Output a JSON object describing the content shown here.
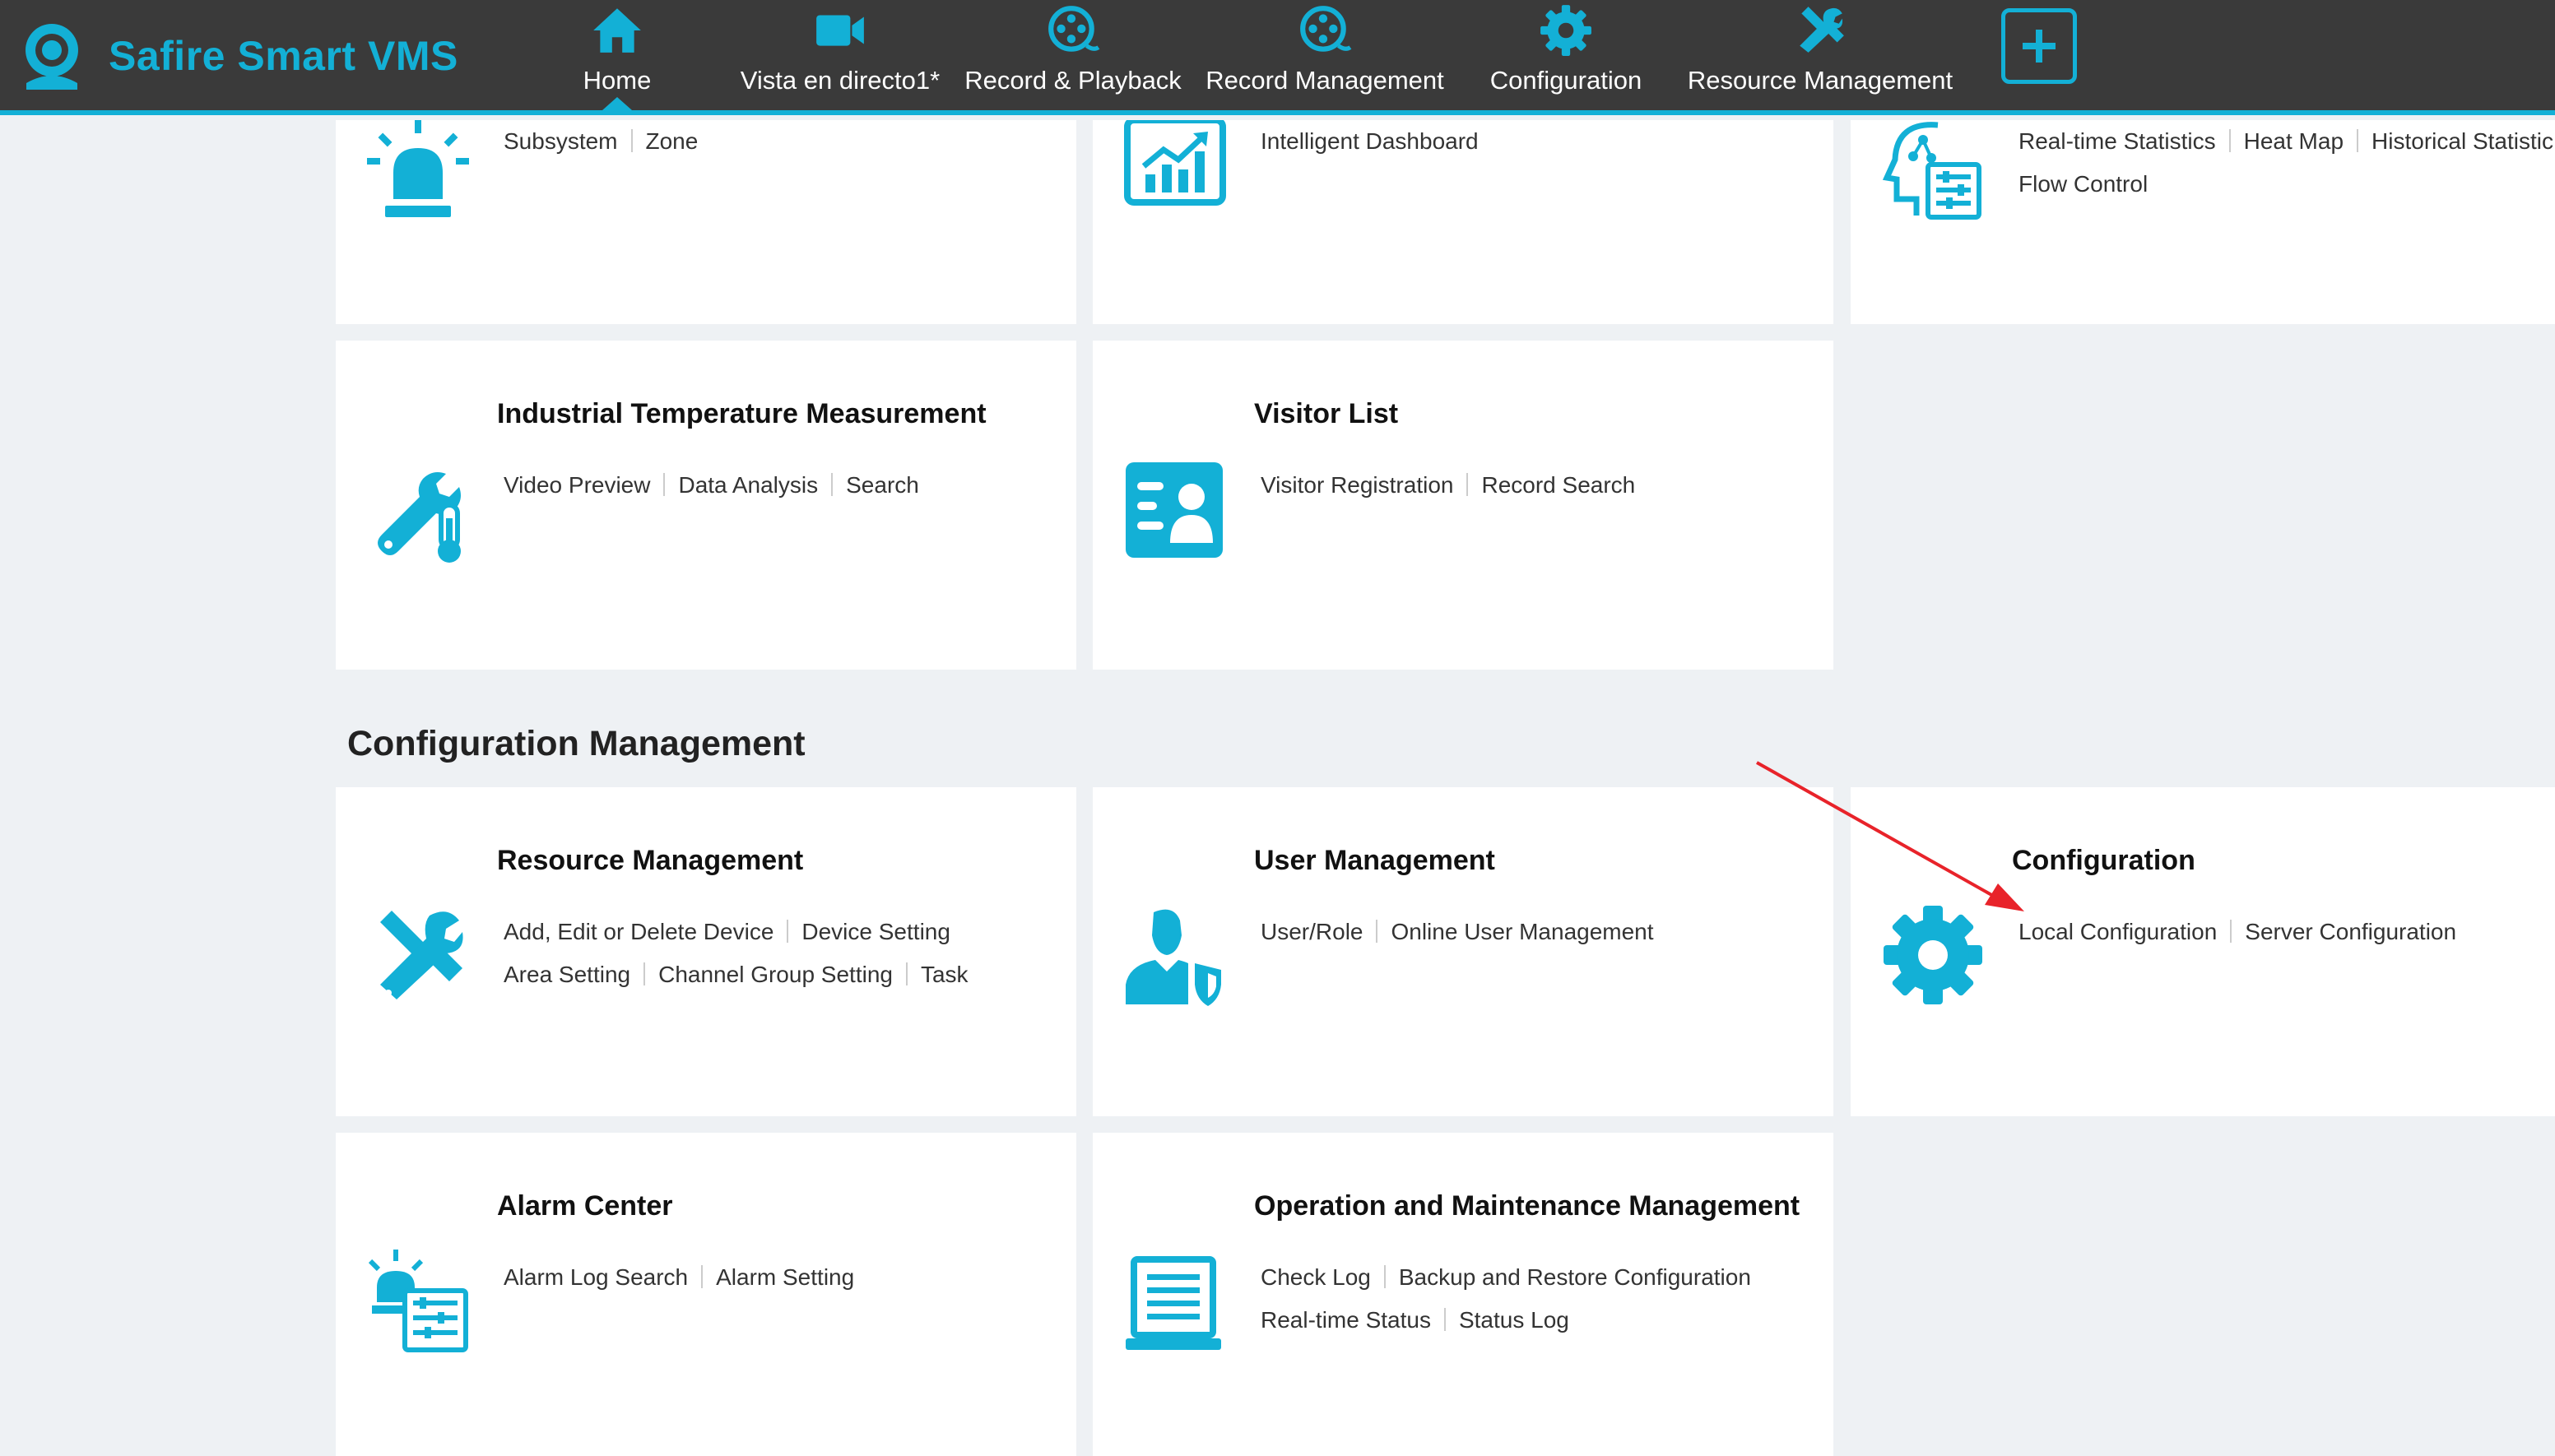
{
  "app": {
    "name": "Safire Smart VMS"
  },
  "nav": {
    "home": "Home",
    "live": "Vista en directo1*",
    "playback": "Record & Playback",
    "record_mgmt": "Record Management",
    "configuration": "Configuration",
    "resource_mgmt": "Resource Management"
  },
  "colors": {
    "accent": "#13b0d6",
    "topbar": "#3a3a3a",
    "background": "#eef1f4",
    "annotation_arrow": "#e8232a"
  },
  "cards": {
    "alarm_subsystem": {
      "icon": "alarm-light-icon",
      "links": [
        "Subsystem",
        "Zone"
      ]
    },
    "intelligent_dashboard": {
      "icon": "chart-icon",
      "links": [
        "Intelligent Dashboard"
      ]
    },
    "people_counting": {
      "icon": "head-analytics-icon",
      "links_row1": [
        "Real-time Statistics",
        "Heat Map",
        "Historical Statistic"
      ],
      "links_row2": [
        "Flow Control"
      ]
    },
    "industrial_temp": {
      "title": "Industrial Temperature Measurement",
      "icon": "wrench-thermometer-icon",
      "links": [
        "Video Preview",
        "Data Analysis",
        "Search"
      ]
    },
    "visitor_list": {
      "title": "Visitor List",
      "icon": "visitor-card-icon",
      "links": [
        "Visitor Registration",
        "Record Search"
      ]
    },
    "resource_management": {
      "title": "Resource Management",
      "icon": "tools-icon",
      "links_row1": [
        "Add, Edit or Delete Device",
        "Device Setting"
      ],
      "links_row2": [
        "Area Setting",
        "Channel Group Setting",
        "Task"
      ]
    },
    "user_management": {
      "title": "User Management",
      "icon": "user-shield-icon",
      "links": [
        "User/Role",
        "Online User Management"
      ]
    },
    "configuration": {
      "title": "Configuration",
      "icon": "gear-icon",
      "links": [
        "Local Configuration",
        "Server Configuration"
      ]
    },
    "alarm_center": {
      "title": "Alarm Center",
      "icon": "alarm-center-icon",
      "links": [
        "Alarm Log Search",
        "Alarm Setting"
      ]
    },
    "operation_maintenance": {
      "title": "Operation and Maintenance Management",
      "icon": "monitor-document-icon",
      "links_row1": [
        "Check Log",
        "Backup and Restore Configuration"
      ],
      "links_row2": [
        "Real-time Status",
        "Status Log"
      ]
    }
  },
  "sections": {
    "configuration_management": "Configuration Management"
  }
}
